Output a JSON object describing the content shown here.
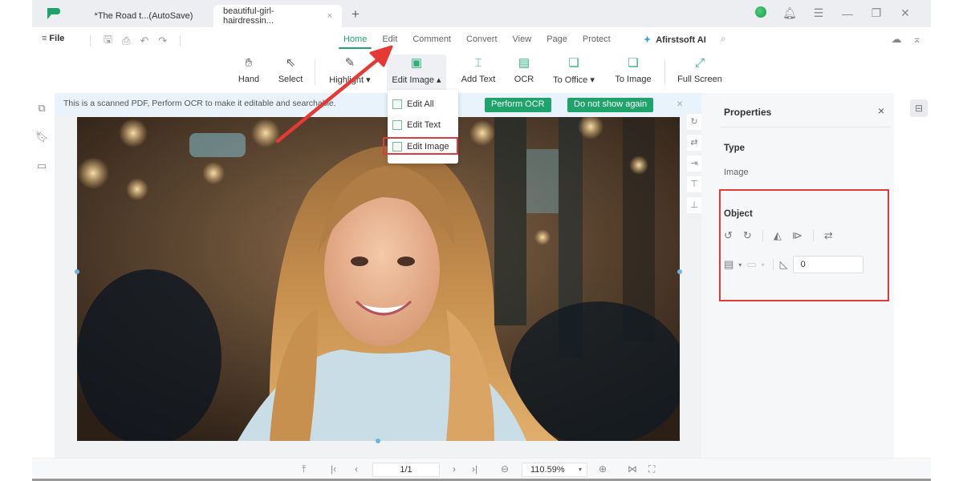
{
  "titlebar": {
    "logo": "app-logo",
    "tabs": [
      {
        "label": "*The Road t...(AutoSave)",
        "active": false
      },
      {
        "label": "beautiful-girl-hairdressin...",
        "active": true,
        "close": "×"
      }
    ],
    "new_tab": "+",
    "controls": {
      "bell": "🔔︎",
      "menu": "☰",
      "minimize": "—",
      "restore": "❐",
      "close": "✕"
    }
  },
  "menubar": {
    "file": "File",
    "file_icon": "≡",
    "quick_icons": {
      "save": "🖫︎",
      "print": "⎙",
      "undo": "↶",
      "redo": "↷"
    },
    "menus": [
      "Home",
      "Edit",
      "Comment",
      "Convert",
      "View",
      "Page",
      "Protect"
    ],
    "active_menu": "Home",
    "ai_icon": "✦",
    "ai_label": "Afirstsoft AI",
    "search_icon": "⌕",
    "cloud_icon": "☁",
    "collapse_icon": "⌅"
  },
  "toolbar": {
    "tools": [
      {
        "label": "Hand",
        "icon": "✋︎"
      },
      {
        "label": "Select",
        "icon": "⇖"
      },
      {
        "label": "Highlight ▾",
        "icon": "✎"
      },
      {
        "label": "Edit Image ▴",
        "icon": "▣"
      },
      {
        "label": "Add Text",
        "icon": "⌶"
      },
      {
        "label": "OCR",
        "icon": "▤"
      },
      {
        "label": "To Office ▾",
        "icon": "❏"
      },
      {
        "label": "To Image",
        "icon": "❏"
      },
      {
        "label": "Full Screen",
        "icon": "⤢"
      }
    ]
  },
  "edit_dropdown": {
    "items": [
      "Edit All",
      "Edit Text",
      "Edit Image"
    ],
    "highlighted": "Edit Image"
  },
  "notice": {
    "text": "This is a scanned PDF, Perform OCR to make it editable and searchable.",
    "perform_ocr": "Perform OCR",
    "do_not_show": "Do not show again",
    "close": "×"
  },
  "left_sidebar": {
    "icons": [
      "thumbnail-icon",
      "bookmark-icon",
      "comment-icon"
    ],
    "glyphs": [
      "⧉",
      "🔖︎",
      "▭"
    ]
  },
  "side_tools": {
    "glyphs": [
      "↻",
      "⇄",
      "⇥",
      "⊤",
      "⊥"
    ]
  },
  "properties": {
    "title": "Properties",
    "close": "×",
    "type_label": "Type",
    "type_value": "Image",
    "object_label": "Object",
    "rotate_left": "↺",
    "rotate_right": "↻",
    "flip_h": "◭",
    "flip_v": "⧐",
    "replace": "⇄",
    "align": "▤",
    "distribute": "▭",
    "angle": "◺",
    "rotation_value": "0"
  },
  "rightbar": {
    "icon": "⊟"
  },
  "statusbar": {
    "top": "⤒",
    "first": "|‹",
    "prev": "‹",
    "page": "1/1",
    "next": "›",
    "last": "›|",
    "zoom_out": "⊖",
    "zoom": "110.59%",
    "zoom_dropdown": "▾",
    "zoom_in": "⊕",
    "fit": "⋈",
    "fit_page": "⛶"
  },
  "colors": {
    "accent": "#1ea36a",
    "annotation": "#e03a3a",
    "notice_bg": "#e8f3fc"
  }
}
